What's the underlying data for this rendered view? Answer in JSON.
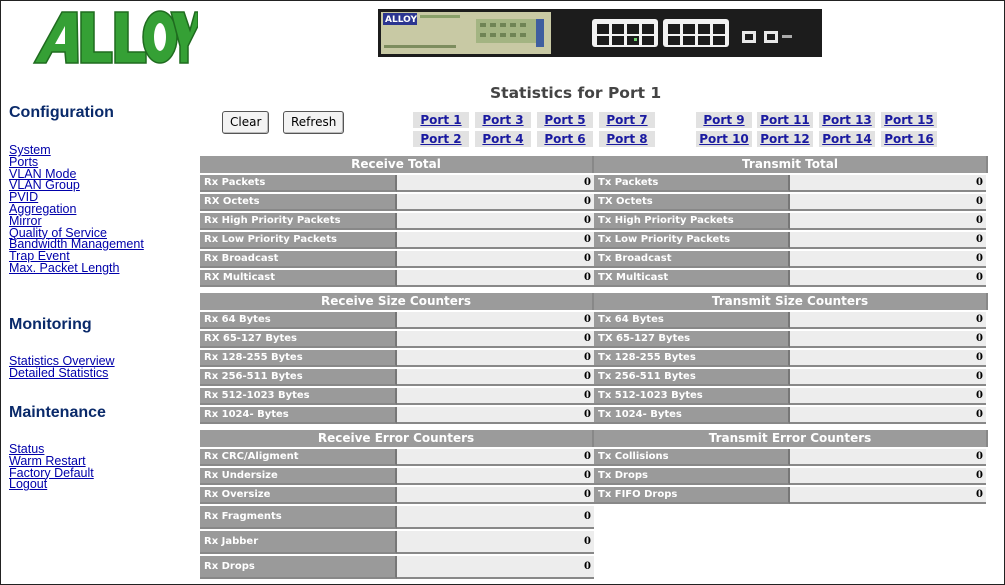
{
  "brand": {
    "logo_text": "ALLOY",
    "banner_text": "ALLOY 16 Port Gigabit Switch"
  },
  "sidebar": {
    "configuration": {
      "heading": "Configuration",
      "links": [
        "System",
        "Ports",
        "VLAN Mode",
        "VLAN Group",
        "PVID",
        "Aggregation",
        "Mirror",
        "Quality of Service",
        "Bandwidth Management",
        "Trap Event",
        "Max. Packet Length"
      ]
    },
    "monitoring": {
      "heading": "Monitoring",
      "links": [
        "Statistics Overview",
        "Detailed Statistics"
      ]
    },
    "maintenance": {
      "heading": "Maintenance",
      "links": [
        "Status",
        "Warm Restart",
        "Factory Default",
        "Logout"
      ]
    }
  },
  "page": {
    "title": "Statistics for Port 1",
    "clear_label": "Clear",
    "refresh_label": "Refresh"
  },
  "ports": [
    "Port 1",
    "Port 2",
    "Port 3",
    "Port 4",
    "Port 5",
    "Port 6",
    "Port 7",
    "Port 8",
    "Port 9",
    "Port 10",
    "Port 11",
    "Port 12",
    "Port 13",
    "Port 14",
    "Port 15",
    "Port 16"
  ],
  "receive": [
    {
      "header": "Receive Total",
      "rows": [
        {
          "label": "Rx Packets",
          "value": "0"
        },
        {
          "label": "RX Octets",
          "value": "0"
        },
        {
          "label": "Rx High Priority Packets",
          "value": "0"
        },
        {
          "label": "Rx Low Priority Packets",
          "value": "0"
        },
        {
          "label": "Rx Broadcast",
          "value": "0"
        },
        {
          "label": "RX Multicast",
          "value": "0"
        }
      ]
    },
    {
      "header": "Receive Size Counters",
      "rows": [
        {
          "label": "Rx 64 Bytes",
          "value": "0"
        },
        {
          "label": "RX 65-127 Bytes",
          "value": "0"
        },
        {
          "label": "Rx 128-255 Bytes",
          "value": "0"
        },
        {
          "label": "Rx 256-511 Bytes",
          "value": "0"
        },
        {
          "label": "Rx 512-1023 Bytes",
          "value": "0"
        },
        {
          "label": "Rx 1024- Bytes",
          "value": "0"
        }
      ]
    },
    {
      "header": "Receive Error Counters",
      "rows": [
        {
          "label": "Rx CRC/Aligment",
          "value": "0"
        },
        {
          "label": "Rx Undersize",
          "value": "0"
        },
        {
          "label": "Rx Oversize",
          "value": "0"
        },
        {
          "label": "Rx Fragments",
          "value": "0"
        },
        {
          "label": "Rx Jabber",
          "value": "0"
        },
        {
          "label": "Rx Drops",
          "value": "0"
        }
      ]
    }
  ],
  "transmit": [
    {
      "header": "Transmit Total",
      "rows": [
        {
          "label": "Tx Packets",
          "value": "0"
        },
        {
          "label": "TX Octets",
          "value": "0"
        },
        {
          "label": "Tx High Priority Packets",
          "value": "0"
        },
        {
          "label": "Tx Low Priority Packets",
          "value": "0"
        },
        {
          "label": "Tx Broadcast",
          "value": "0"
        },
        {
          "label": "TX Multicast",
          "value": "0"
        }
      ]
    },
    {
      "header": "Transmit Size Counters",
      "rows": [
        {
          "label": "Tx 64 Bytes",
          "value": "0"
        },
        {
          "label": "TX 65-127 Bytes",
          "value": "0"
        },
        {
          "label": "Tx 128-255 Bytes",
          "value": "0"
        },
        {
          "label": "Tx 256-511 Bytes",
          "value": "0"
        },
        {
          "label": "Tx 512-1023 Bytes",
          "value": "0"
        },
        {
          "label": "Tx 1024- Bytes",
          "value": "0"
        }
      ]
    },
    {
      "header": "Transmit Error Counters",
      "rows": [
        {
          "label": "Tx Collisions",
          "value": "0"
        },
        {
          "label": "Tx Drops",
          "value": "0"
        },
        {
          "label": "Tx FIFO Drops",
          "value": "0"
        }
      ]
    }
  ],
  "colors": {
    "header_bg": "#9b9b9b",
    "label_bg": "#9a9a9a",
    "value_bg": "#ededed",
    "link": "#1a1aa0",
    "logo_green": "#2f9a2f"
  }
}
